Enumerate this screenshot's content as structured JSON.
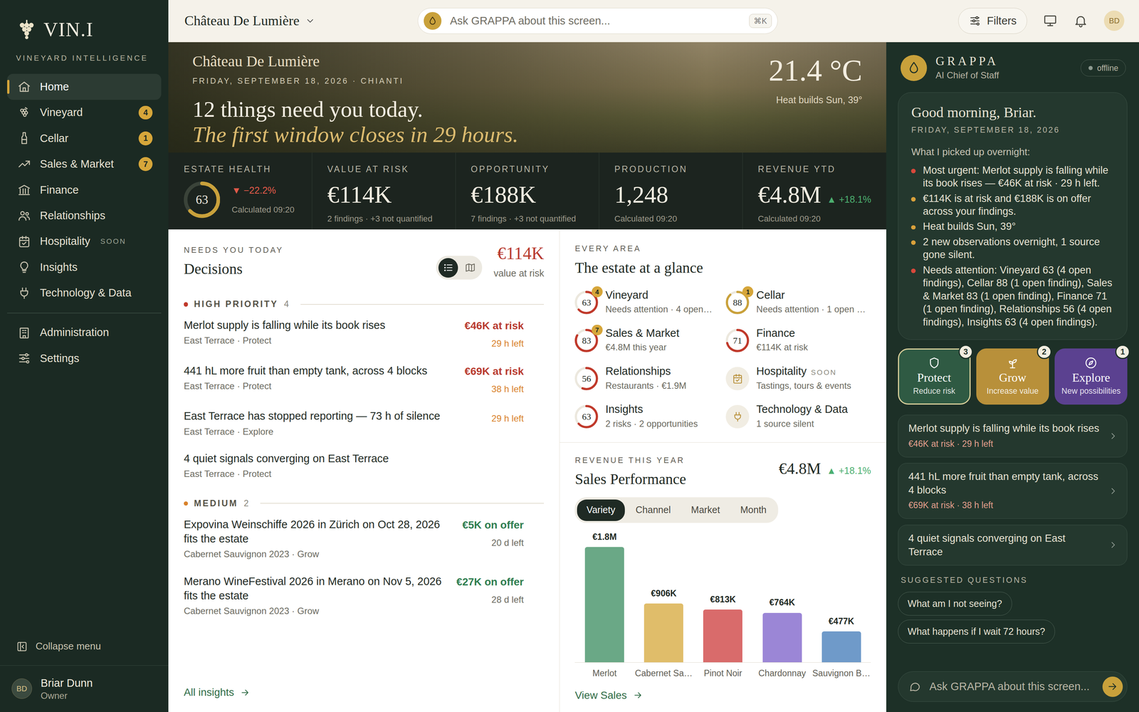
{
  "brand": {
    "name": "VIN.I",
    "tagline": "VINEYARD INTELLIGENCE"
  },
  "sidebar": {
    "groups": [
      [
        {
          "label": "Home",
          "selected": true
        },
        {
          "label": "Vineyard",
          "badge": "4",
          "selected": false
        },
        {
          "label": "Cellar",
          "badge": "1",
          "selected": false
        },
        {
          "label": "Sales & Market",
          "badge": "7",
          "selected": false
        },
        {
          "label": "Finance",
          "selected": false
        },
        {
          "label": "Relationships",
          "selected": false
        },
        {
          "label": "Hospitality",
          "tag": "SOON",
          "selected": false
        },
        {
          "label": "Insights",
          "selected": false
        },
        {
          "label": "Technology & Data",
          "selected": false
        }
      ],
      [
        {
          "label": "Administration",
          "selected": false
        },
        {
          "label": "Settings",
          "selected": false
        }
      ]
    ],
    "collapse": "Collapse menu",
    "user": {
      "initials": "BD",
      "name": "Briar Dunn",
      "role": "Owner"
    }
  },
  "topbar": {
    "estate": "Château De Lumière",
    "search": {
      "placeholder": "Ask GRAPPA about this screen...",
      "shortcut": "⌘K"
    },
    "filters": "Filters",
    "avatar": "BD"
  },
  "hero": {
    "estate": "Château De Lumière",
    "meta": "FRIDAY, SEPTEMBER 18, 2026 · CHIANTI",
    "headline": "12 things need you today.",
    "subline": "The first window closes in 29 hours.",
    "temp": "21.4 °C",
    "forecast": "Heat builds Sun, 39°"
  },
  "kpis": [
    {
      "label": "ESTATE HEALTH",
      "kind": "ring",
      "value": "63",
      "level": 0.63,
      "delta": "▼ −22.2%",
      "trend": "down",
      "note": "Calculated 09:20"
    },
    {
      "label": "VALUE AT RISK",
      "kind": "value",
      "value": "€114K",
      "note": "2 findings · +3 not quantified"
    },
    {
      "label": "OPPORTUNITY",
      "kind": "value",
      "value": "€188K",
      "note": "7 findings · +3 not quantified"
    },
    {
      "label": "PRODUCTION",
      "kind": "value",
      "value": "1,248",
      "note": "Calculated 09:20"
    },
    {
      "label": "REVENUE YTD",
      "kind": "value",
      "value": "€4.8M",
      "delta": "▲ +18.1%",
      "trend": "up",
      "note": "Calculated 09:20"
    }
  ],
  "decisions": {
    "eyebrow": "NEEDS YOU TODAY",
    "title": "Decisions",
    "views": [
      {
        "kind": "list",
        "selected": true
      },
      {
        "kind": "map",
        "selected": false
      }
    ],
    "total": "€114K",
    "total_label": "value at risk",
    "groups": [
      {
        "label": "HIGH PRIORITY",
        "count": "4",
        "color": "#c0392b",
        "items": [
          {
            "title": "Merlot supply is falling while its book rises",
            "sub": "East Terrace · Protect",
            "amount": "€46K at risk",
            "kind": "risk",
            "due": "29 h left",
            "urgent": true
          },
          {
            "title": "441 hL more fruit than empty tank, across 4 blocks",
            "sub": "East Terrace · Protect",
            "amount": "€69K at risk",
            "kind": "risk",
            "due": "38 h left",
            "urgent": true
          },
          {
            "title": "East Terrace has stopped reporting — 73 h of silence",
            "sub": "East Terrace · Explore",
            "due": "29 h left",
            "urgent": true
          },
          {
            "title": "4 quiet signals converging on East Terrace",
            "sub": "East Terrace · Protect"
          }
        ]
      },
      {
        "label": "MEDIUM",
        "count": "2",
        "color": "#d9822b",
        "items": [
          {
            "title": "Expovina Weinschiffe 2026 in Zürich on Oct 28, 2026 fits the estate",
            "sub": "Cabernet Sauvignon 2023 · Grow",
            "amount": "€5K on offer",
            "kind": "offer",
            "due": "20 d left",
            "urgent": false
          },
          {
            "title": "Merano WineFestival 2026 in Merano on Nov 5, 2026 fits the estate",
            "sub": "Cabernet Sauvignon 2023 · Grow",
            "amount": "€27K on offer",
            "kind": "offer",
            "due": "28 d left",
            "urgent": false
          }
        ]
      }
    ],
    "footer": "All insights"
  },
  "glance": {
    "eyebrow": "EVERY AREA",
    "title": "The estate at a glance",
    "areas": [
      {
        "name": "Vineyard",
        "status": "Needs attention · 4 open…",
        "kind": "ring",
        "score": "63",
        "level": 0.63,
        "color": "#c0392b",
        "badge": "4"
      },
      {
        "name": "Cellar",
        "status": "Needs attention · 1 open …",
        "kind": "ring",
        "score": "88",
        "level": 0.88,
        "color": "#c9a13b",
        "badge": "1"
      },
      {
        "name": "Sales & Market",
        "status": "€4.8M this year",
        "kind": "ring",
        "score": "83",
        "level": 0.83,
        "color": "#c0392b",
        "badge": "7"
      },
      {
        "name": "Finance",
        "status": "€114K at risk",
        "kind": "ring",
        "score": "71",
        "level": 0.71,
        "color": "#c0392b"
      },
      {
        "name": "Relationships",
        "status": "Restaurants · €1.9M",
        "kind": "ring",
        "score": "56",
        "level": 0.56,
        "color": "#c0392b"
      },
      {
        "name": "Hospitality",
        "tag": "SOON",
        "status": "Tastings, tours & events",
        "kind": "icon"
      },
      {
        "name": "Insights",
        "status": "2 risks · 2 opportunities",
        "kind": "ring",
        "score": "63",
        "level": 0.63,
        "color": "#c0392b"
      },
      {
        "name": "Technology & Data",
        "status": "1 source silent",
        "kind": "icon"
      }
    ]
  },
  "sales": {
    "eyebrow": "REVENUE THIS YEAR",
    "title": "Sales Performance",
    "total": "€4.8M",
    "delta": "▲ +18.1%",
    "tabs": [
      {
        "label": "Variety",
        "selected": true
      },
      {
        "label": "Channel",
        "selected": false
      },
      {
        "label": "Market",
        "selected": false
      },
      {
        "label": "Month",
        "selected": false
      }
    ],
    "chart": {
      "bars": [
        {
          "label": "Merlot",
          "value": 1800,
          "reading": "€1.8M",
          "color": "#6aa886"
        },
        {
          "label": "Cabernet Sa…",
          "value": 906,
          "reading": "€906K",
          "color": "#e0bd6a"
        },
        {
          "label": "Pinot Noir",
          "value": 813,
          "reading": "€813K",
          "color": "#d96b6b"
        },
        {
          "label": "Chardonnay",
          "value": 764,
          "reading": "€764K",
          "color": "#9b86d6"
        },
        {
          "label": "Sauvignon B…",
          "value": 477,
          "reading": "€477K",
          "color": "#6f9ac9"
        }
      ]
    },
    "footer": "View Sales"
  },
  "grappa": {
    "name": "GRAPPA",
    "role": "AI Chief of Staff",
    "status": "offline",
    "greeting": "Good morning, Briar.",
    "date": "FRIDAY, SEPTEMBER 18, 2026",
    "intro": "What I picked up overnight:",
    "notes": [
      {
        "text": "Most urgent: Merlot supply is falling while its book rises — €46K at risk · 29 h left.",
        "color": "#d9483b"
      },
      {
        "text": "€114K is at risk and €188K is on offer across your findings.",
        "color": "#d9a13b"
      },
      {
        "text": "Heat builds Sun, 39°",
        "color": "#d9a13b"
      },
      {
        "text": "2 new observations overnight, 1 source gone silent.",
        "color": "#d9a13b"
      },
      {
        "text": "Needs attention: Vineyard 63 (4 open findings), Cellar 88 (1 open finding), Sales & Market 83 (1 open finding), Finance 71 (1 open finding), Relationships 56 (4 open findings), Insights 63 (4 open findings).",
        "color": "#d9483b"
      }
    ],
    "modes": [
      {
        "label": "Protect",
        "sub": "Reduce risk",
        "count": "3",
        "selected": true,
        "color": "#2f5a43"
      },
      {
        "label": "Grow",
        "sub": "Increase value",
        "count": "2",
        "selected": false,
        "color": "#b8903a"
      },
      {
        "label": "Explore",
        "sub": "New possibilities",
        "count": "1",
        "selected": false,
        "color": "#5b4190"
      }
    ],
    "cards": [
      {
        "title": "Merlot supply is falling while its book rises",
        "meta": "€46K at risk · 29 h left"
      },
      {
        "title": "441 hL more fruit than empty tank, across 4 blocks",
        "meta": "€69K at risk · 38 h left"
      },
      {
        "title": "4 quiet signals converging on East Terrace"
      }
    ],
    "questions_label": "SUGGESTED QUESTIONS",
    "questions": [
      "What am I not seeing?",
      "What happens if I wait 72 hours?"
    ],
    "input": {
      "placeholder": "Ask GRAPPA about this screen..."
    }
  }
}
